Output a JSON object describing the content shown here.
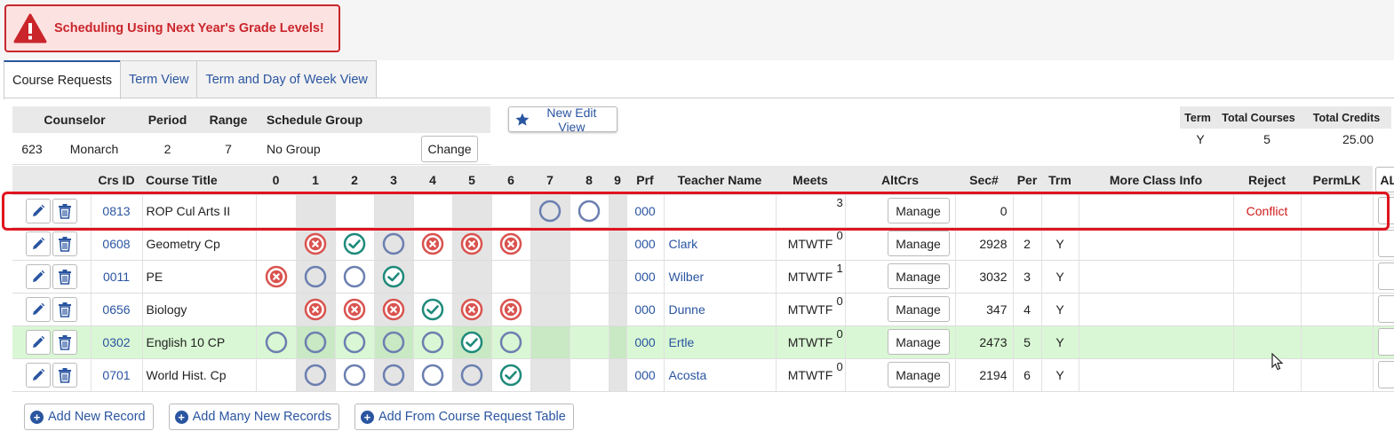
{
  "alert": {
    "text": "Scheduling Using Next Year's Grade Levels!"
  },
  "tabs": [
    "Course Requests",
    "Term View",
    "Term and Day of Week View"
  ],
  "counselor_info": {
    "headers": {
      "counselor": "Counselor",
      "period": "Period",
      "range": "Range",
      "schedule_group": "Schedule Group"
    },
    "number": "623",
    "name": "Monarch",
    "period": "2",
    "range": "7",
    "schedule_group": "No Group",
    "change_label": "Change"
  },
  "new_edit_view_label": "New Edit View",
  "totals": {
    "headers": {
      "term": "Term",
      "total_courses": "Total Courses",
      "total_credits": "Total Credits"
    },
    "term": "Y",
    "total_courses": "5",
    "total_credits": "25.00"
  },
  "grid": {
    "headers": {
      "crs_id": "Crs ID",
      "course_title": "Course Title",
      "periods": [
        "0",
        "1",
        "2",
        "3",
        "4",
        "5",
        "6",
        "7",
        "8",
        "9"
      ],
      "prf": "Prf",
      "teacher": "Teacher Name",
      "meets": "Meets",
      "altcrs": "AltCrs",
      "sec": "Sec#",
      "per": "Per",
      "trm": "Trm",
      "more": "More Class Info",
      "reject": "Reject",
      "permlk": "PermLK",
      "all": "ALL"
    },
    "manage_label": "Manage",
    "rows": [
      {
        "crs_id": "0813",
        "title": "ROP Cul Arts II",
        "slots": [
          "",
          "",
          "",
          "",
          "",
          "",
          "",
          "open",
          "open",
          ""
        ],
        "prf": "000",
        "teacher": "",
        "meets": "",
        "alt": "3",
        "sec": "0",
        "per": "",
        "trm": "",
        "more": "",
        "reject": "Conflict",
        "permlk": "",
        "highlight": false,
        "outlined": true
      },
      {
        "crs_id": "0608",
        "title": "Geometry Cp",
        "slots": [
          "",
          "x",
          "check",
          "open",
          "x",
          "x",
          "x",
          "",
          "",
          ""
        ],
        "prf": "000",
        "teacher": "Clark",
        "meets": "MTWTF",
        "alt": "0",
        "sec": "2928",
        "per": "2",
        "trm": "Y",
        "more": "",
        "reject": "",
        "permlk": "",
        "highlight": false
      },
      {
        "crs_id": "0011",
        "title": "PE",
        "slots": [
          "x",
          "open",
          "open",
          "check",
          "",
          "",
          "",
          "",
          "",
          ""
        ],
        "prf": "000",
        "teacher": "Wilber",
        "meets": "MTWTF",
        "alt": "1",
        "sec": "3032",
        "per": "3",
        "trm": "Y",
        "more": "",
        "reject": "",
        "permlk": "",
        "highlight": false
      },
      {
        "crs_id": "0656",
        "title": "Biology",
        "slots": [
          "",
          "x",
          "x",
          "x",
          "check",
          "x",
          "x",
          "",
          "",
          ""
        ],
        "prf": "000",
        "teacher": "Dunne",
        "meets": "MTWTF",
        "alt": "0",
        "sec": "347",
        "per": "4",
        "trm": "Y",
        "more": "",
        "reject": "",
        "permlk": "",
        "highlight": false
      },
      {
        "crs_id": "0302",
        "title": "English 10 CP",
        "slots": [
          "open",
          "open",
          "open",
          "open",
          "open",
          "check",
          "open",
          "",
          "",
          ""
        ],
        "prf": "000",
        "teacher": "Ertle",
        "meets": "MTWTF",
        "alt": "0",
        "sec": "2473",
        "per": "5",
        "trm": "Y",
        "more": "",
        "reject": "",
        "permlk": "",
        "highlight": true
      },
      {
        "crs_id": "0701",
        "title": "World Hist. Cp",
        "slots": [
          "",
          "open",
          "open",
          "open",
          "open",
          "open",
          "check",
          "",
          "",
          ""
        ],
        "prf": "000",
        "teacher": "Acosta",
        "meets": "MTWTF",
        "alt": "0",
        "sec": "2194",
        "per": "6",
        "trm": "Y",
        "more": "",
        "reject": "",
        "permlk": "",
        "highlight": false
      }
    ]
  },
  "bottom_buttons": [
    "Add New Record",
    "Add Many New Records",
    "Add From Course Request Table"
  ],
  "icons": {
    "edit": "pencil-icon",
    "delete": "trash-icon",
    "star": "star-icon",
    "warning": "warning-triangle-icon",
    "open": "open-circle-icon",
    "check": "check-circle-icon",
    "x": "x-circle-icon",
    "plus": "plus-circle-icon"
  },
  "colors": {
    "alert_red": "#c9252b",
    "link_blue": "#2a55a0",
    "check_teal": "#1e8a7a",
    "x_red": "#d9534f",
    "open_blue": "#6b7fb0",
    "highlight_green": "#d9f7d4"
  }
}
